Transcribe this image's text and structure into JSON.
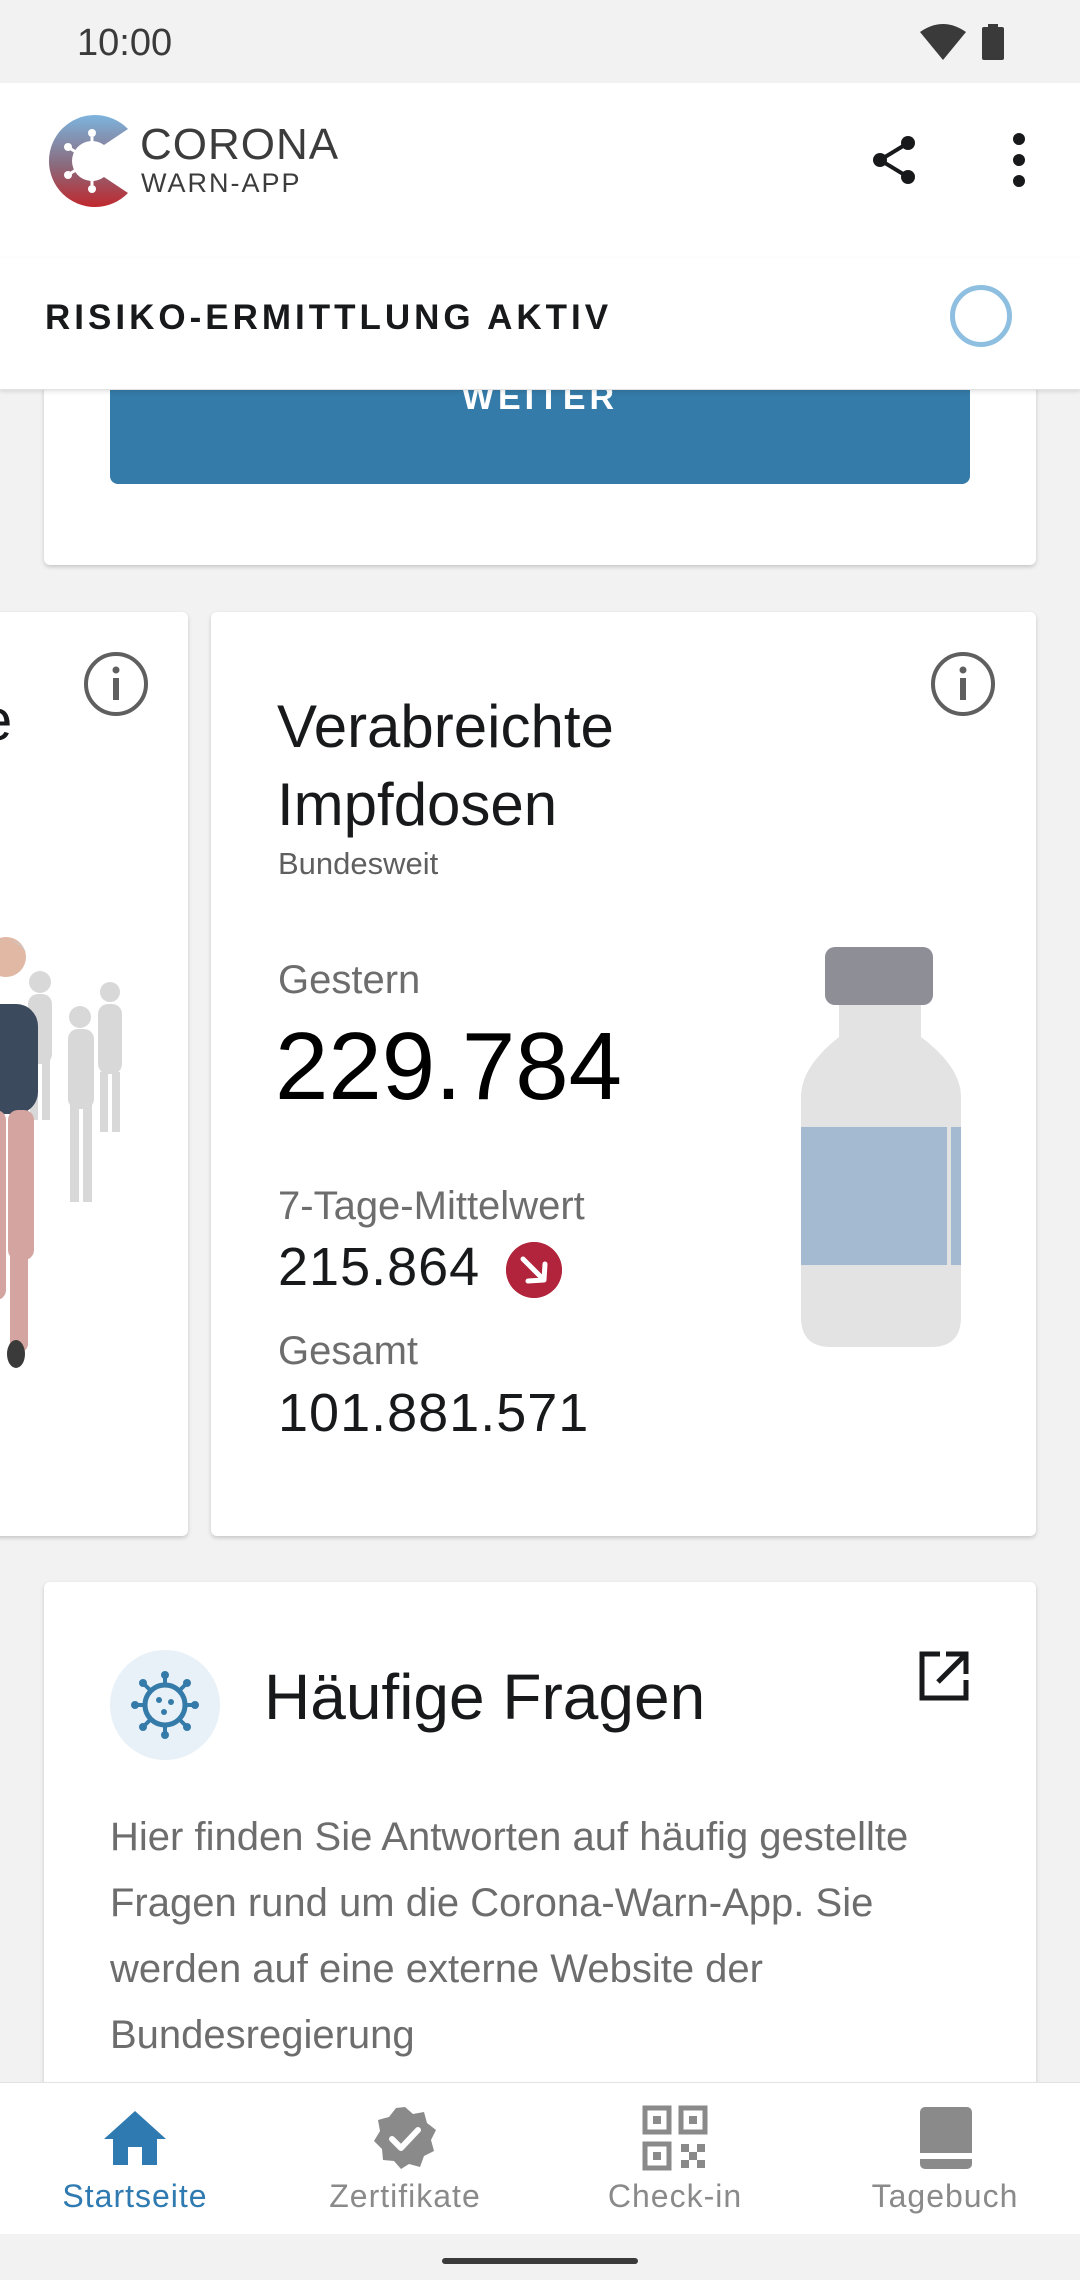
{
  "status_bar": {
    "time": "10:00"
  },
  "app_bar": {
    "logo_line1": "CORONA",
    "logo_line2": "WARN-APP",
    "share_icon": "share-icon",
    "more_icon": "more-vert-icon"
  },
  "risk_header": {
    "label": "RISIKO-ERMITTLUNG AKTIV"
  },
  "top_card": {
    "button_label": "WEITER"
  },
  "left_card": {
    "partial_title": "e"
  },
  "vaccination_card": {
    "title": "Verabreichte Impfdosen",
    "subtitle": "Bundesweit",
    "yesterday_label": "Gestern",
    "yesterday_value": "229.784",
    "avg_label": "7-Tage-Mittelwert",
    "avg_value": "215.864",
    "trend_icon": "trend-down-icon",
    "total_label": "Gesamt",
    "total_value": "101.881.571"
  },
  "faq_card": {
    "title": "Häufige Fragen",
    "text": "Hier finden Sie Antworten auf häufig gestellte Fragen rund um die Corona-Warn-App. Sie werden auf eine externe Website der Bundesregierung"
  },
  "bottom_nav": {
    "items": [
      {
        "label": "Startseite",
        "icon": "home-icon",
        "active": true
      },
      {
        "label": "Zertifikate",
        "icon": "certificate-icon",
        "active": false
      },
      {
        "label": "Check-in",
        "icon": "qr-code-icon",
        "active": false
      },
      {
        "label": "Tagebuch",
        "icon": "diary-icon",
        "active": false
      }
    ]
  },
  "colors": {
    "primary": "#357ba9",
    "nav_active": "#2f7ab0",
    "trend_red": "#b1243b",
    "spinner": "#8fbfe0"
  }
}
